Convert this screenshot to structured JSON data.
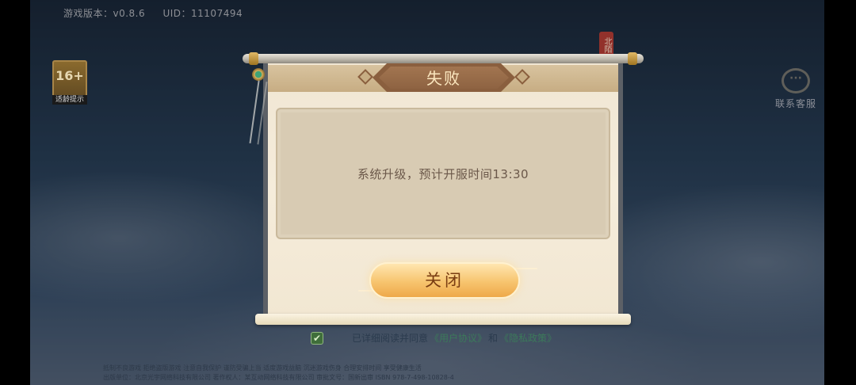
{
  "header": {
    "version": "游戏版本：v0.8.6",
    "uid": "UID：11107494"
  },
  "age_badge": {
    "rating": "16+",
    "label": "适龄提示"
  },
  "service": {
    "label": "联系客服"
  },
  "seal_text": "北陌",
  "dialog": {
    "title": "失败",
    "message": "系统升级，预计开服时间13:30",
    "close_label": "关闭"
  },
  "agreement": {
    "checked": true,
    "checkmark": "✔",
    "prefix": "已详细阅读并同意",
    "user_agreement": "《用户协议》",
    "and": "和",
    "privacy": "《隐私政策》"
  },
  "legal": {
    "line1": "抵制不良游戏 拒绝盗版游戏 注意自我保护 谨防受骗上当 适度游戏益脑 沉迷游戏伤身 合理安排时间 享受健康生活",
    "line2": "出版单位：北京光宇网络科技有限公司 著作权人：某互动网络科技有限公司 审批文号：国新出审 ISBN 978-7-498-10828-4"
  },
  "colors": {
    "title_text": "#fbe7bf",
    "message_text": "#6b584a",
    "button_text": "#7a3d12",
    "button_fill": "#f7c46e"
  }
}
